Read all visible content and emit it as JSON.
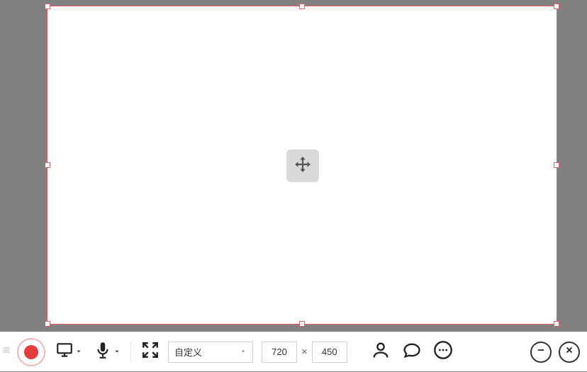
{
  "capture": {
    "width_value": "720",
    "height_value": "450",
    "mode_label": "自定义"
  },
  "toolbar": {
    "times_symbol": "×"
  }
}
